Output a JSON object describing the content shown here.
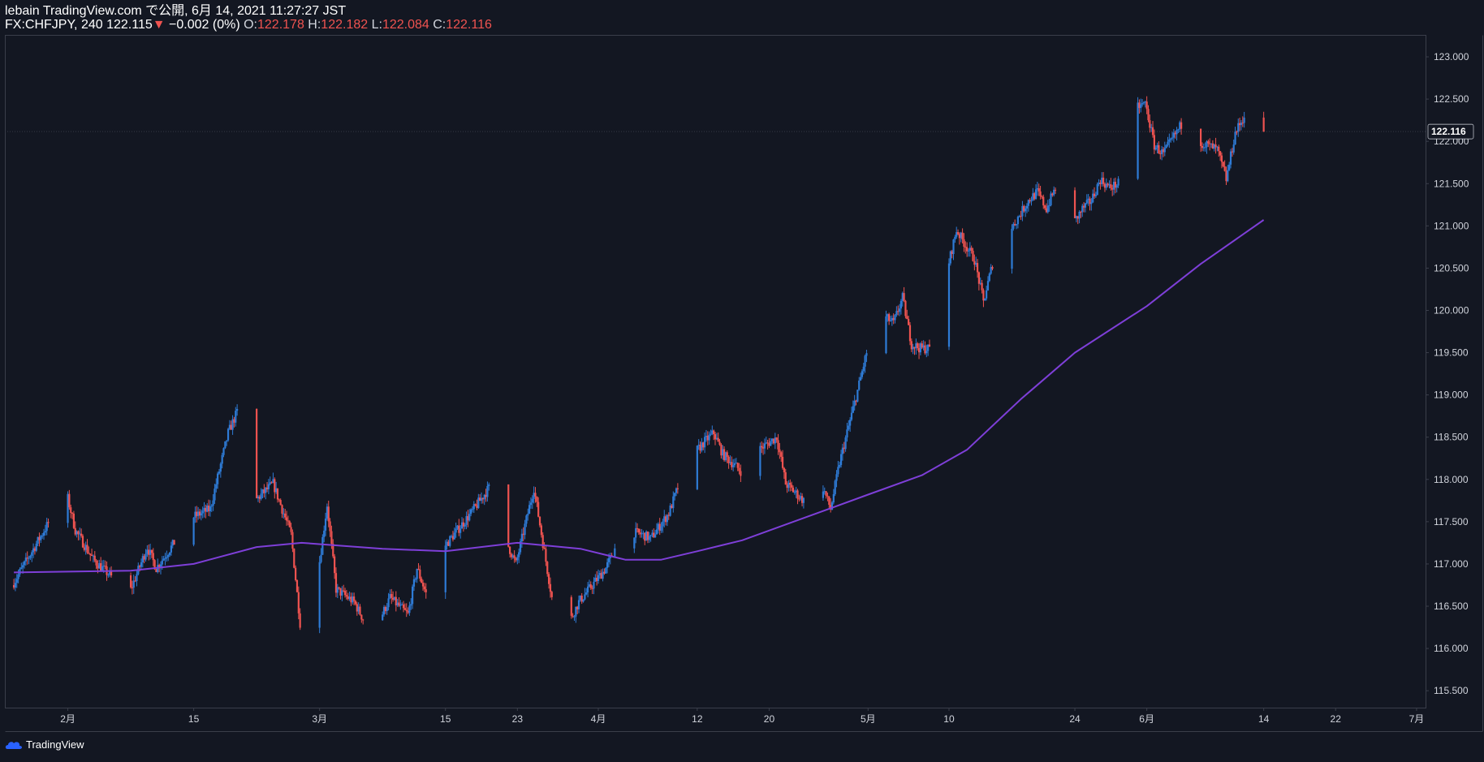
{
  "header": {
    "publish_line": "lebain TradingView.com で公開, 6月 14, 2021 11:27:27 JST",
    "symbol": "FX:CHFJPY, 240",
    "last": "122.115",
    "change_arrow": "▼",
    "change": "−0.002 (0%)",
    "o_label": "O:",
    "o_value": "122.178",
    "h_label": "H:",
    "h_value": "122.182",
    "l_label": "L:",
    "l_value": "122.084",
    "c_label": "C:",
    "c_value": "122.116"
  },
  "price_label": "122.116",
  "footer": {
    "brand": "TradingView"
  },
  "colors": {
    "background": "#131722",
    "up": "#2e7bd6",
    "down": "#ef5350",
    "ma": "#7e3fd8",
    "axis_text": "#d1d4dc",
    "border": "#3a3e4a"
  },
  "chart_data": {
    "type": "candlestick",
    "symbol": "FX:CHFJPY",
    "interval": "240",
    "ylim": [
      115.3,
      123.25
    ],
    "y_ticks": [
      "123.000",
      "122.500",
      "122.000",
      "121.500",
      "121.000",
      "120.500",
      "120.000",
      "119.500",
      "119.000",
      "118.500",
      "118.000",
      "117.500",
      "117.000",
      "116.500",
      "116.000",
      "115.500"
    ],
    "x_ticks": [
      "2月",
      "15",
      "3月",
      "15",
      "23",
      "4月",
      "12",
      "20",
      "5月",
      "10",
      "24",
      "6月",
      "14",
      "22",
      "7月"
    ],
    "x_tick_dates": [
      "2021-02-01",
      "2021-02-15",
      "2021-03-01",
      "2021-03-15",
      "2021-03-23",
      "2021-04-01",
      "2021-04-12",
      "2021-04-20",
      "2021-05-01",
      "2021-05-10",
      "2021-05-24",
      "2021-06-01",
      "2021-06-14",
      "2021-06-22",
      "2021-07-01"
    ],
    "price_path": [
      {
        "date": "2021-01-26",
        "close": 116.75
      },
      {
        "date": "2021-01-29",
        "close": 117.3
      },
      {
        "date": "2021-02-01",
        "close": 117.85
      },
      {
        "date": "2021-02-02",
        "close": 117.4
      },
      {
        "date": "2021-02-04",
        "close": 117.05
      },
      {
        "date": "2021-02-08",
        "close": 116.65
      },
      {
        "date": "2021-02-10",
        "close": 117.2
      },
      {
        "date": "2021-02-11",
        "close": 116.95
      },
      {
        "date": "2021-02-15",
        "close": 117.55
      },
      {
        "date": "2021-02-17",
        "close": 117.65
      },
      {
        "date": "2021-02-19",
        "close": 118.55
      },
      {
        "date": "2021-02-20",
        "close": 118.8
      },
      {
        "date": "2021-02-22",
        "close": 117.75
      },
      {
        "date": "2021-02-24",
        "close": 117.95
      },
      {
        "date": "2021-02-26",
        "close": 117.35
      },
      {
        "date": "2021-02-27",
        "close": 116.3
      },
      {
        "date": "2021-03-01",
        "close": 116.9
      },
      {
        "date": "2021-03-02",
        "close": 117.7
      },
      {
        "date": "2021-03-03",
        "close": 116.7
      },
      {
        "date": "2021-03-05",
        "close": 116.55
      },
      {
        "date": "2021-03-07",
        "close": 116.15
      },
      {
        "date": "2021-03-09",
        "close": 116.6
      },
      {
        "date": "2021-03-11",
        "close": 116.4
      },
      {
        "date": "2021-03-12",
        "close": 116.95
      },
      {
        "date": "2021-03-14",
        "close": 116.35
      },
      {
        "date": "2021-03-15",
        "close": 117.2
      },
      {
        "date": "2021-03-18",
        "close": 117.6
      },
      {
        "date": "2021-03-21",
        "close": 118.05
      },
      {
        "date": "2021-03-22",
        "close": 117.25
      },
      {
        "date": "2021-03-23",
        "close": 117.0
      },
      {
        "date": "2021-03-25",
        "close": 117.9
      },
      {
        "date": "2021-03-27",
        "close": 116.6
      },
      {
        "date": "2021-03-28",
        "close": 116.1
      },
      {
        "date": "2021-03-30",
        "close": 116.55
      },
      {
        "date": "2021-04-02",
        "close": 116.95
      },
      {
        "date": "2021-04-04",
        "close": 117.4
      },
      {
        "date": "2021-04-06",
        "close": 117.35
      },
      {
        "date": "2021-04-07",
        "close": 117.3
      },
      {
        "date": "2021-04-09",
        "close": 117.6
      },
      {
        "date": "2021-04-11",
        "close": 118.2
      },
      {
        "date": "2021-04-13",
        "close": 118.45
      },
      {
        "date": "2021-04-14",
        "close": 118.55
      },
      {
        "date": "2021-04-15",
        "close": 118.3
      },
      {
        "date": "2021-04-17",
        "close": 118.1
      },
      {
        "date": "2021-04-18",
        "close": 117.75
      },
      {
        "date": "2021-04-19",
        "close": 118.35
      },
      {
        "date": "2021-04-21",
        "close": 118.5
      },
      {
        "date": "2021-04-22",
        "close": 117.95
      },
      {
        "date": "2021-04-24",
        "close": 117.75
      },
      {
        "date": "2021-04-25",
        "close": 117.55
      },
      {
        "date": "2021-04-26",
        "close": 117.95
      },
      {
        "date": "2021-04-27",
        "close": 117.65
      },
      {
        "date": "2021-04-28",
        "close": 118.2
      },
      {
        "date": "2021-04-30",
        "close": 119.05
      },
      {
        "date": "2021-05-01",
        "close": 119.5
      },
      {
        "date": "2021-05-02",
        "close": 120.0
      },
      {
        "date": "2021-05-04",
        "close": 119.85
      },
      {
        "date": "2021-05-05",
        "close": 120.15
      },
      {
        "date": "2021-05-06",
        "close": 119.6
      },
      {
        "date": "2021-05-07",
        "close": 119.55
      },
      {
        "date": "2021-05-08",
        "close": 119.55
      },
      {
        "date": "2021-05-09",
        "close": 119.7
      },
      {
        "date": "2021-05-10",
        "close": 120.5
      },
      {
        "date": "2021-05-11",
        "close": 120.95
      },
      {
        "date": "2021-05-13",
        "close": 120.6
      },
      {
        "date": "2021-05-14",
        "close": 120.1
      },
      {
        "date": "2021-05-15",
        "close": 120.55
      },
      {
        "date": "2021-05-17",
        "close": 120.95
      },
      {
        "date": "2021-05-19",
        "close": 121.3
      },
      {
        "date": "2021-05-20",
        "close": 121.4
      },
      {
        "date": "2021-05-21",
        "close": 121.2
      },
      {
        "date": "2021-05-22",
        "close": 121.45
      },
      {
        "date": "2021-05-23",
        "close": 120.85
      },
      {
        "date": "2021-05-25",
        "close": 121.2
      },
      {
        "date": "2021-05-26",
        "close": 121.3
      },
      {
        "date": "2021-05-27",
        "close": 121.55
      },
      {
        "date": "2021-05-28",
        "close": 121.45
      },
      {
        "date": "2021-05-30",
        "close": 121.55
      },
      {
        "date": "2021-05-31",
        "close": 122.4
      },
      {
        "date": "2021-06-01",
        "close": 122.45
      },
      {
        "date": "2021-06-02",
        "close": 121.95
      },
      {
        "date": "2021-06-03",
        "close": 121.85
      },
      {
        "date": "2021-06-05",
        "close": 122.2
      },
      {
        "date": "2021-06-07",
        "close": 122.0
      },
      {
        "date": "2021-06-09",
        "close": 121.9
      },
      {
        "date": "2021-06-10",
        "close": 121.55
      },
      {
        "date": "2021-06-11",
        "close": 122.1
      },
      {
        "date": "2021-06-12",
        "close": 122.3
      },
      {
        "date": "2021-06-13",
        "close": 122.4
      },
      {
        "date": "2021-06-14",
        "close": 122.116
      }
    ],
    "ma_path": [
      {
        "date": "2021-01-26",
        "value": 116.9
      },
      {
        "date": "2021-02-08",
        "value": 116.92
      },
      {
        "date": "2021-02-15",
        "value": 117.0
      },
      {
        "date": "2021-02-22",
        "value": 117.2
      },
      {
        "date": "2021-02-27",
        "value": 117.25
      },
      {
        "date": "2021-03-08",
        "value": 117.18
      },
      {
        "date": "2021-03-15",
        "value": 117.15
      },
      {
        "date": "2021-03-23",
        "value": 117.25
      },
      {
        "date": "2021-03-30",
        "value": 117.18
      },
      {
        "date": "2021-04-04",
        "value": 117.05
      },
      {
        "date": "2021-04-08",
        "value": 117.05
      },
      {
        "date": "2021-04-12",
        "value": 117.15
      },
      {
        "date": "2021-04-17",
        "value": 117.28
      },
      {
        "date": "2021-04-24",
        "value": 117.55
      },
      {
        "date": "2021-05-01",
        "value": 117.82
      },
      {
        "date": "2021-05-07",
        "value": 118.05
      },
      {
        "date": "2021-05-12",
        "value": 118.35
      },
      {
        "date": "2021-05-18",
        "value": 118.95
      },
      {
        "date": "2021-05-24",
        "value": 119.5
      },
      {
        "date": "2021-06-01",
        "value": 120.05
      },
      {
        "date": "2021-06-07",
        "value": 120.55
      },
      {
        "date": "2021-06-14",
        "value": 121.07
      }
    ]
  }
}
